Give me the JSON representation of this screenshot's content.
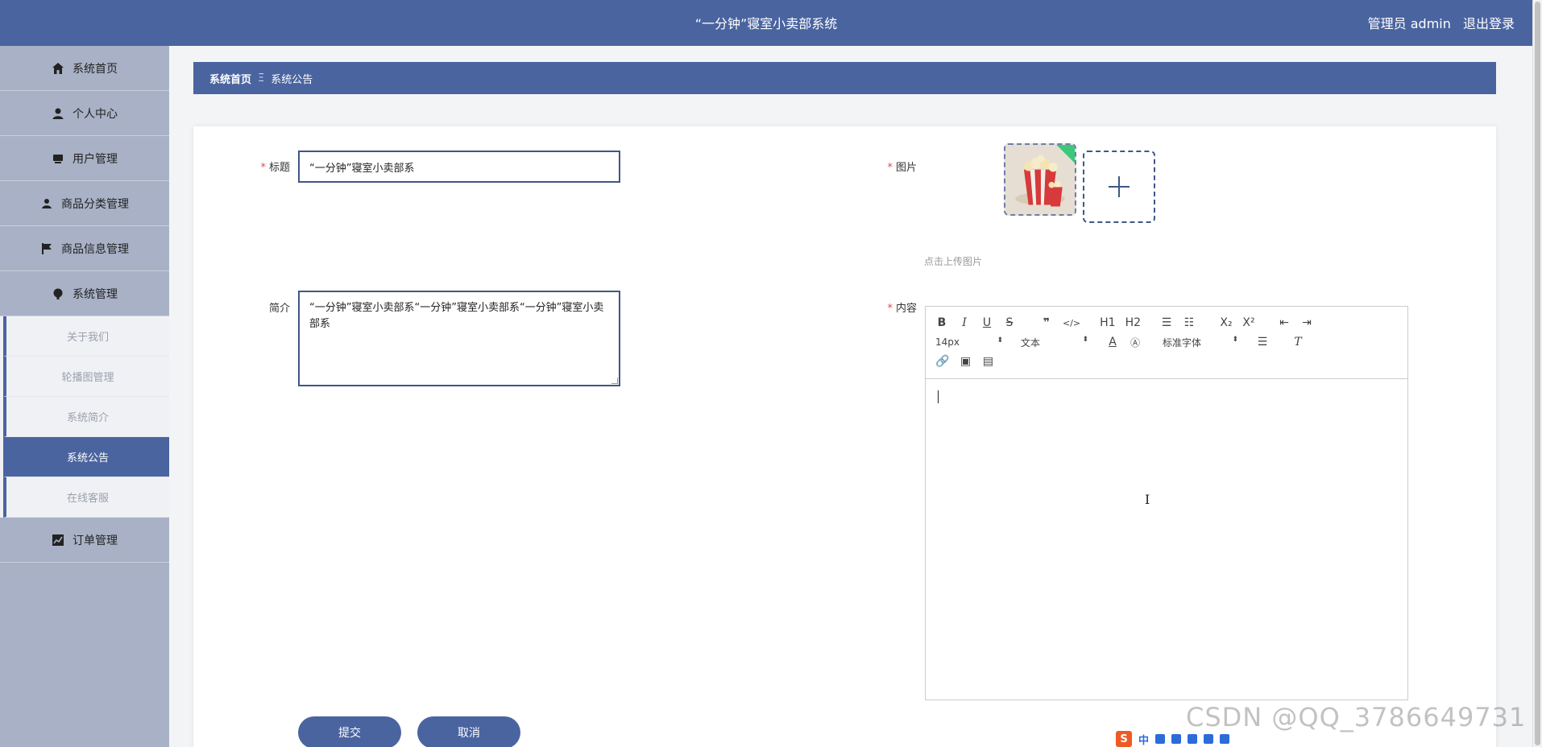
{
  "header": {
    "title": "“一分钟”寝室小卖部系统",
    "user_label": "管理员 admin",
    "logout_label": "退出登录"
  },
  "sidebar": {
    "items": [
      {
        "label": "系统首页",
        "icon": "home-icon"
      },
      {
        "label": "个人中心",
        "icon": "user-icon"
      },
      {
        "label": "用户管理",
        "icon": "users-icon"
      },
      {
        "label": "商品分类管理",
        "icon": "category-icon"
      },
      {
        "label": "商品信息管理",
        "icon": "flag-icon"
      },
      {
        "label": "系统管理",
        "icon": "settings-icon"
      }
    ],
    "subitems": [
      {
        "label": "关于我们"
      },
      {
        "label": "轮播图管理"
      },
      {
        "label": "系统简介"
      },
      {
        "label": "系统公告",
        "active": true
      },
      {
        "label": "在线客服"
      }
    ],
    "last_item": {
      "label": "订单管理",
      "icon": "chart-icon"
    }
  },
  "breadcrumb": {
    "home": "系统首页",
    "separator": "Ξ",
    "current": "系统公告"
  },
  "form": {
    "title_label": "标题",
    "title_value": "“一分钟”寝室小卖部系",
    "intro_label": "简介",
    "intro_value": "“一分钟”寝室小卖部系“一分钟”寝室小卖部系“一分钟”寝室小卖部系",
    "image_label": "图片",
    "upload_hint": "点击上传图片",
    "content_label": "内容",
    "required_mark": "*",
    "submit_label": "提交",
    "cancel_label": "取消"
  },
  "editor": {
    "font_size": "14px",
    "text_type": "文本",
    "font_family": "标准字体",
    "h1": "H1",
    "h2": "H2",
    "bold": "B",
    "italic": "I",
    "underline": "U",
    "strike": "S"
  },
  "overlay": {
    "watermark": "CSDN @QQ_3786649731",
    "ime_logo": "S",
    "ime_mode": "中"
  },
  "colors": {
    "primary": "#4a64a0",
    "sidebar_bg": "#a8b1c6",
    "required": "#e24a4a"
  }
}
